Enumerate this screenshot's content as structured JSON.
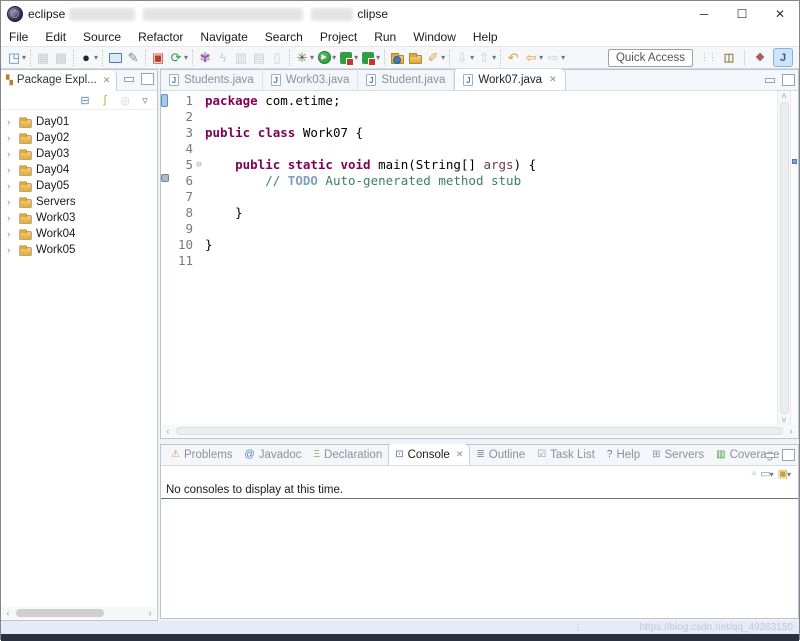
{
  "window": {
    "title_prefix": "eclipse",
    "title_suffix_fragment": "clipse",
    "controls": {
      "minimize": "─",
      "maximize": "☐",
      "close": "✕"
    }
  },
  "menu": {
    "items": [
      "File",
      "Edit",
      "Source",
      "Refactor",
      "Navigate",
      "Search",
      "Project",
      "Run",
      "Window",
      "Help"
    ]
  },
  "toolbar": {
    "quick_access_label": "Quick Access",
    "icons": [
      {
        "name": "new-wizard-icon",
        "glyph": "◳",
        "color": "#5b87b7",
        "dd": true
      },
      {
        "sep": true
      },
      {
        "name": "save-icon",
        "glyph": "▦",
        "color": "#c9ced6",
        "disabled": true
      },
      {
        "name": "save-all-icon",
        "glyph": "▩",
        "color": "#c9ced6",
        "disabled": true
      },
      {
        "sep": true
      },
      {
        "name": "user-profile-icon",
        "glyph": "●",
        "color": "#1d2733",
        "dd": true
      },
      {
        "sep": true
      },
      {
        "name": "open-terminal-icon",
        "kind": "monitor"
      },
      {
        "name": "scrapbook-icon",
        "glyph": "✎",
        "color": "#7d8aa0"
      },
      {
        "sep": true
      },
      {
        "name": "new-plugin-icon",
        "glyph": "▣",
        "color": "#c0392b"
      },
      {
        "name": "refresh-icon",
        "glyph": "⟳",
        "color": "#2f9e44",
        "dd": true
      },
      {
        "sep": true
      },
      {
        "name": "type-hierarchy-icon",
        "glyph": "✾",
        "color": "#8e5ea8"
      },
      {
        "name": "lightning-icon",
        "glyph": "ϟ",
        "color": "#c9ced6",
        "disabled": true
      },
      {
        "name": "mark-occurrences-icon",
        "glyph": "▥",
        "color": "#c9ced6",
        "disabled": true
      },
      {
        "name": "link-editor-icon",
        "glyph": "▤",
        "color": "#c9ced6",
        "disabled": true
      },
      {
        "name": "pin-editor-icon",
        "glyph": "▯",
        "color": "#c9ced6",
        "disabled": true
      },
      {
        "sep": true
      },
      {
        "name": "debug-icon",
        "glyph": "✳",
        "color": "#56652f",
        "dd": true
      },
      {
        "name": "run-icon",
        "kind": "run",
        "dd": true
      },
      {
        "name": "coverage-icon",
        "kind": "cov",
        "dd": true
      },
      {
        "name": "profile-icon",
        "kind": "cov",
        "dd": true
      },
      {
        "sep": true
      },
      {
        "name": "open-web-folder-icon",
        "kind": "folder-globe"
      },
      {
        "name": "open-folder-icon",
        "kind": "folder"
      },
      {
        "name": "torch-search-icon",
        "glyph": "✐",
        "color": "#d9a13a",
        "dd": true
      },
      {
        "sep": true
      },
      {
        "name": "last-edit-location-icon",
        "glyph": "⇩",
        "color": "#c9ced6",
        "disabled": true,
        "dd": true
      },
      {
        "name": "next-annotation-icon",
        "glyph": "⇧",
        "color": "#c9ced6",
        "disabled": true,
        "dd": true
      },
      {
        "sep": true
      },
      {
        "name": "back-history-icon",
        "glyph": "↶",
        "color": "#d9a13a"
      },
      {
        "name": "back-icon",
        "glyph": "⇦",
        "color": "#d9a13a",
        "dd": true
      },
      {
        "name": "forward-icon",
        "glyph": "⇨",
        "color": "#c9ced6",
        "dd": true
      }
    ],
    "perspectives": [
      {
        "name": "open-perspective-icon",
        "glyph": "◫",
        "color": "#8a7a4a",
        "active": false
      },
      {
        "name": "javaee-perspective-icon",
        "glyph": "❖",
        "color": "#a55a5a",
        "active": false
      },
      {
        "name": "java-perspective-icon",
        "glyph": "J",
        "color": "#2b5f9e",
        "active": true
      }
    ]
  },
  "package_explorer": {
    "tab_label": "Package Expl...",
    "tab_close": "✕",
    "tools": [
      {
        "name": "collapse-all-icon",
        "glyph": "⊟",
        "color": "#5b87b7"
      },
      {
        "name": "link-with-editor-icon",
        "glyph": "ʃ",
        "color": "#c9a13a"
      },
      {
        "name": "focus-icon",
        "glyph": "◎",
        "color": "#c9ced6"
      },
      {
        "name": "view-menu-icon",
        "glyph": "▿",
        "color": "#6b7686"
      }
    ],
    "items": [
      {
        "label": "Day01"
      },
      {
        "label": "Day02"
      },
      {
        "label": "Day03"
      },
      {
        "label": "Day04"
      },
      {
        "label": "Day05"
      },
      {
        "label": "Servers"
      },
      {
        "label": "Work03"
      },
      {
        "label": "Work04"
      },
      {
        "label": "Work05"
      }
    ]
  },
  "editor": {
    "tabs": [
      {
        "label": "Students.java",
        "active": false
      },
      {
        "label": "Work03.java",
        "active": false
      },
      {
        "label": "Student.java",
        "active": false
      },
      {
        "label": "Work07.java",
        "active": true,
        "close": "✕"
      }
    ],
    "fold_glyph": "⊖",
    "lines": [
      {
        "num": "1",
        "marker": "range",
        "tokens": [
          {
            "t": "kw",
            "v": "package"
          },
          {
            "t": "plain",
            "v": " com.etime;"
          }
        ]
      },
      {
        "num": "2",
        "tokens": []
      },
      {
        "num": "3",
        "tokens": [
          {
            "t": "kw",
            "v": "public"
          },
          {
            "t": "plain",
            "v": " "
          },
          {
            "t": "kw",
            "v": "class"
          },
          {
            "t": "plain",
            "v": " Work07 {"
          }
        ]
      },
      {
        "num": "4",
        "tokens": []
      },
      {
        "num": "5",
        "fold": true,
        "tokens": [
          {
            "t": "plain",
            "v": "    "
          },
          {
            "t": "kw",
            "v": "public"
          },
          {
            "t": "plain",
            "v": " "
          },
          {
            "t": "kw",
            "v": "static"
          },
          {
            "t": "plain",
            "v": " "
          },
          {
            "t": "kw",
            "v": "void"
          },
          {
            "t": "plain",
            "v": " main(String[] "
          },
          {
            "t": "param",
            "v": "args"
          },
          {
            "t": "plain",
            "v": ") {"
          }
        ]
      },
      {
        "num": "6",
        "marker": "task",
        "tokens": [
          {
            "t": "plain",
            "v": "        "
          },
          {
            "t": "comment",
            "v": "// "
          },
          {
            "t": "todo",
            "v": "TODO"
          },
          {
            "t": "comment",
            "v": " Auto-generated method stub"
          }
        ]
      },
      {
        "num": "7",
        "tokens": []
      },
      {
        "num": "8",
        "tokens": [
          {
            "t": "plain",
            "v": "    }"
          }
        ]
      },
      {
        "num": "9",
        "tokens": []
      },
      {
        "num": "10",
        "tokens": [
          {
            "t": "plain",
            "v": "}"
          }
        ]
      },
      {
        "num": "11",
        "tokens": []
      }
    ]
  },
  "console": {
    "tabs": [
      {
        "label": "Problems",
        "icon": "problems-icon",
        "glyph": "⚠",
        "color": "#c9a13a",
        "active": false
      },
      {
        "label": "Javadoc",
        "icon": "javadoc-icon",
        "glyph": "@",
        "color": "#4a78b0",
        "active": false
      },
      {
        "label": "Declaration",
        "icon": "declaration-icon",
        "glyph": "Ξ",
        "color": "#9aa24a",
        "active": false
      },
      {
        "label": "Console",
        "icon": "console-icon",
        "glyph": "⊡",
        "color": "#4a78b0",
        "active": true,
        "close": "✕"
      },
      {
        "label": "Outline",
        "icon": "outline-icon",
        "glyph": "≣",
        "color": "#8a94a4",
        "active": false
      },
      {
        "label": "Task List",
        "icon": "task-list-icon",
        "glyph": "☑",
        "color": "#8a94a4",
        "active": false
      },
      {
        "label": "Help",
        "icon": "help-icon",
        "glyph": "?",
        "color": "#4a78b0",
        "active": false
      },
      {
        "label": "Servers",
        "icon": "servers-icon",
        "glyph": "⊞",
        "color": "#8a94a4",
        "active": false
      },
      {
        "label": "Coverage",
        "icon": "coverage-icon",
        "glyph": "▥",
        "color": "#3f9c35",
        "active": false
      }
    ],
    "tools": [
      {
        "name": "pin-console-icon",
        "glyph": "⌖",
        "color": "#c9ced6"
      },
      {
        "name": "display-selected-console-icon",
        "glyph": "▭",
        "color": "#8a94a4",
        "dd": true
      },
      {
        "name": "open-console-icon",
        "glyph": "▣",
        "color": "#c9a13a",
        "dd": true
      }
    ],
    "message": "No consoles to display at this time."
  },
  "status_bar": {
    "watermark": "https://blog.csdn.net/qq_49263150"
  },
  "colors": {
    "keyword": "#7f0055",
    "comment": "#3f7f5f",
    "todo_tag": "#7f9fbf",
    "panel_border": "#b9c3d2",
    "active_perspective_bg": "#cfe3f7",
    "status_bar_bg": "#e7ebf5",
    "bottom_strip": "#2a3040"
  }
}
